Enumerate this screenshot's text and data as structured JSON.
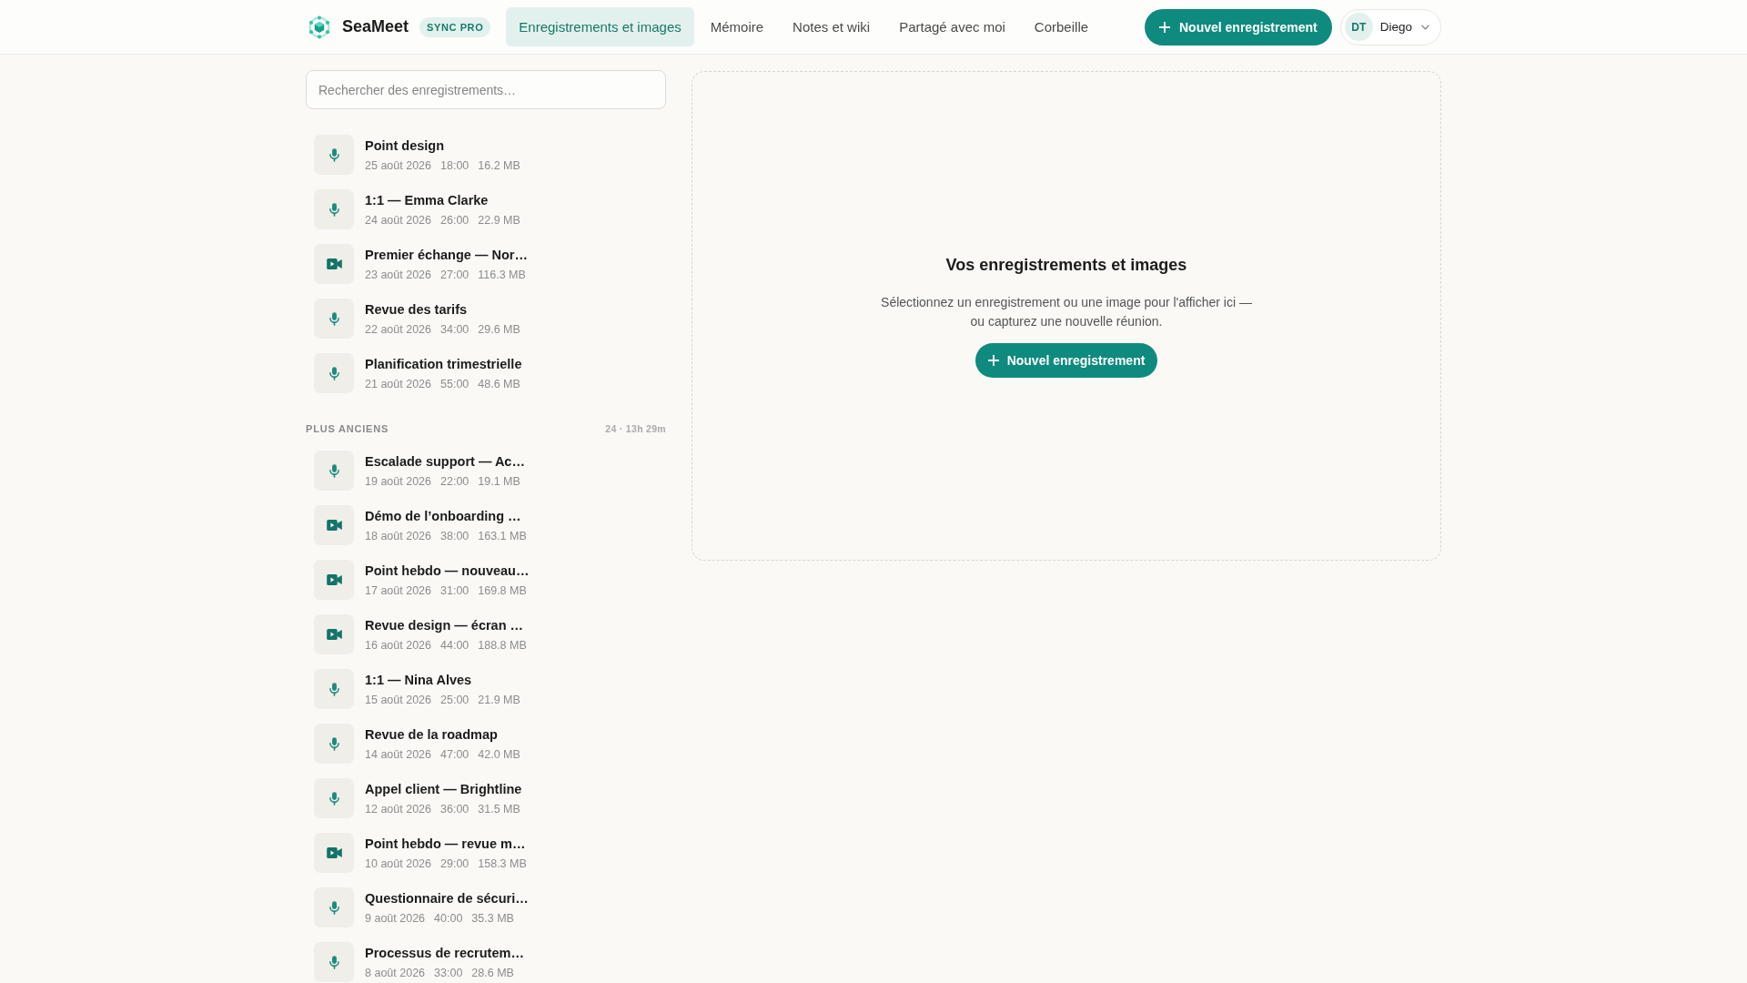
{
  "header": {
    "app_name": "SeaMeet",
    "plan_badge": "SYNC PRO",
    "tabs": [
      {
        "label": "Enregistrements et images",
        "selected": true
      },
      {
        "label": "Mémoire",
        "selected": false
      },
      {
        "label": "Notes et wiki",
        "selected": false
      },
      {
        "label": "Partagé avec moi",
        "selected": false
      },
      {
        "label": "Corbeille",
        "selected": false
      }
    ],
    "new_button": "Nouvel enregistrement",
    "user": {
      "initials": "DT",
      "name": "Diego"
    }
  },
  "sidebar": {
    "search": {
      "placeholder": "Rechercher des enregistrements…"
    },
    "sections": [
      {
        "items": [
          {
            "kind": "audio",
            "title": "Point design",
            "date": "25 août 2026",
            "duration": "18:00",
            "size": "16.2 MB"
          },
          {
            "kind": "audio",
            "title": "1:1 — Emma Clarke",
            "date": "24 août 2026",
            "duration": "26:00",
            "size": "22.9 MB"
          },
          {
            "kind": "video",
            "title": "Premier échange — Nor…",
            "date": "23 août 2026",
            "duration": "27:00",
            "size": "116.3 MB"
          },
          {
            "kind": "audio",
            "title": "Revue des tarifs",
            "date": "22 août 2026",
            "duration": "34:00",
            "size": "29.6 MB"
          },
          {
            "kind": "audio",
            "title": "Planification trimestrielle",
            "date": "21 août 2026",
            "duration": "55:00",
            "size": "48.6 MB"
          }
        ]
      },
      {
        "title": "PLUS ANCIENS",
        "summary": "24 · 13h 29m",
        "items": [
          {
            "kind": "audio",
            "title": "Escalade support — Ac…",
            "date": "19 août 2026",
            "duration": "22:00",
            "size": "19.1 MB"
          },
          {
            "kind": "video",
            "title": "Démo de l’onboarding …",
            "date": "18 août 2026",
            "duration": "38:00",
            "size": "163.1 MB"
          },
          {
            "kind": "video",
            "title": "Point hebdo — nouveau…",
            "date": "17 août 2026",
            "duration": "31:00",
            "size": "169.8 MB"
          },
          {
            "kind": "video",
            "title": "Revue design — écran …",
            "date": "16 août 2026",
            "duration": "44:00",
            "size": "188.8 MB"
          },
          {
            "kind": "audio",
            "title": "1:1 — Nina Alves",
            "date": "15 août 2026",
            "duration": "25:00",
            "size": "21.9 MB"
          },
          {
            "kind": "audio",
            "title": "Revue de la roadmap",
            "date": "14 août 2026",
            "duration": "47:00",
            "size": "42.0 MB"
          },
          {
            "kind": "audio",
            "title": "Appel client — Brightline",
            "date": "12 août 2026",
            "duration": "36:00",
            "size": "31.5 MB"
          },
          {
            "kind": "video",
            "title": "Point hebdo — revue m…",
            "date": "10 août 2026",
            "duration": "29:00",
            "size": "158.3 MB"
          },
          {
            "kind": "audio",
            "title": "Questionnaire de sécuri…",
            "date": "9 août 2026",
            "duration": "40:00",
            "size": "35.3 MB"
          },
          {
            "kind": "audio",
            "title": "Processus de recrutem…",
            "date": "8 août 2026",
            "duration": "33:00",
            "size": "28.6 MB"
          }
        ]
      }
    ]
  },
  "empty_state": {
    "title": "Vos enregistrements et images",
    "text": "Sélectionnez un enregistrement ou une image pour l'afficher ici — ou capturez une nouvelle réunion.",
    "button": "Nouvel enregistrement"
  }
}
